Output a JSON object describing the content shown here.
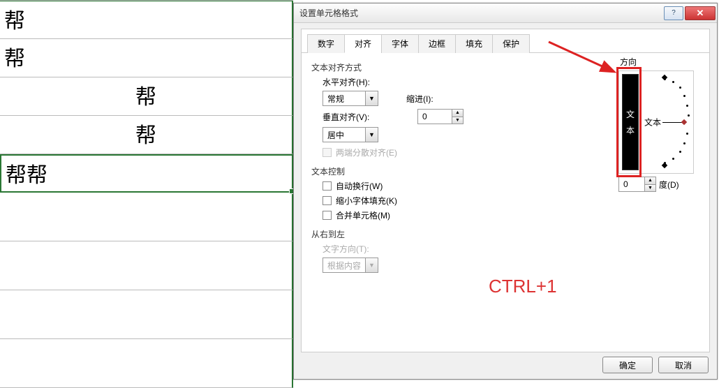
{
  "sheet": {
    "cells": [
      "帮",
      "帮",
      "帮",
      "帮",
      "帮帮"
    ]
  },
  "dialog": {
    "title": "设置单元格格式",
    "tabs": [
      "数字",
      "对齐",
      "字体",
      "边框",
      "填充",
      "保护"
    ],
    "active_tab_index": 1,
    "text_align": {
      "group_label": "文本对齐方式",
      "h_label": "水平对齐(H):",
      "h_value": "常规",
      "indent_label": "缩进(I):",
      "indent_value": "0",
      "v_label": "垂直对齐(V):",
      "v_value": "居中",
      "justify_label": "两端分散对齐(E)"
    },
    "text_control": {
      "group_label": "文本控制",
      "wrap_label": "自动换行(W)",
      "shrink_label": "缩小字体填充(K)",
      "merge_label": "合并单元格(M)"
    },
    "rtl": {
      "group_label": "从右到左",
      "dir_label": "文字方向(T):",
      "dir_value": "根据内容"
    },
    "orientation": {
      "label": "方向",
      "vertical_text": "文本",
      "dial_text": "文本",
      "degrees_value": "0",
      "degrees_label": "度(D)"
    },
    "buttons": {
      "ok": "确定",
      "cancel": "取消"
    }
  },
  "annotation": {
    "shortcut": "CTRL+1"
  }
}
